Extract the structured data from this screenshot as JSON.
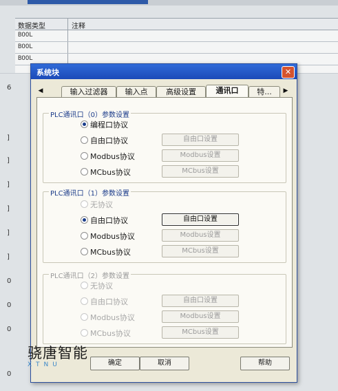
{
  "background": {
    "grid_headers": [
      "数据类型",
      "注释"
    ],
    "grid_rows": [
      "BOOL",
      "BOOL",
      "BOOL"
    ],
    "left_gutter": [
      "6",
      "]",
      "]",
      "]",
      "]",
      "]",
      "]",
      "]",
      "0",
      "0",
      "0",
      "0",
      "0",
      "0"
    ]
  },
  "dialog": {
    "title": "系统块",
    "close_glyph": "✕",
    "tabs": [
      "输入过滤器",
      "输入点",
      "高级设置",
      "通讯口",
      "特..."
    ],
    "active_tab_index": 3,
    "groups": [
      {
        "legend": "PLC通讯口（0）参数设置",
        "options": [
          "编程口协议",
          "自由口协议",
          "Modbus协议",
          "MCbus协议"
        ],
        "selected": 0,
        "buttons": [
          "自由口设置",
          "Modbus设置",
          "MCbus设置"
        ]
      },
      {
        "legend": "PLC通讯口（1）参数设置",
        "options": [
          "无协议",
          "自由口协议",
          "Modbus协议",
          "MCbus协议"
        ],
        "selected": 1,
        "buttons": [
          "自由口设置",
          "Modbus设置",
          "MCbus设置"
        ]
      },
      {
        "legend": "PLC通讯口（2）参数设置",
        "options": [
          "无协议",
          "自由口协议",
          "Modbus协议",
          "MCbus协议"
        ],
        "selected": -1,
        "buttons": [
          "自由口设置",
          "Modbus设置",
          "MCbus设置"
        ]
      }
    ],
    "ok_label": "确定",
    "cancel_label": "取消",
    "help_label": "帮助"
  },
  "watermark": {
    "cn": "骁唐智能",
    "en": "XTNU"
  },
  "colors": {
    "titlebar": "#1b4ab8",
    "close": "#d5532e",
    "legend": "#1c3c8a"
  }
}
